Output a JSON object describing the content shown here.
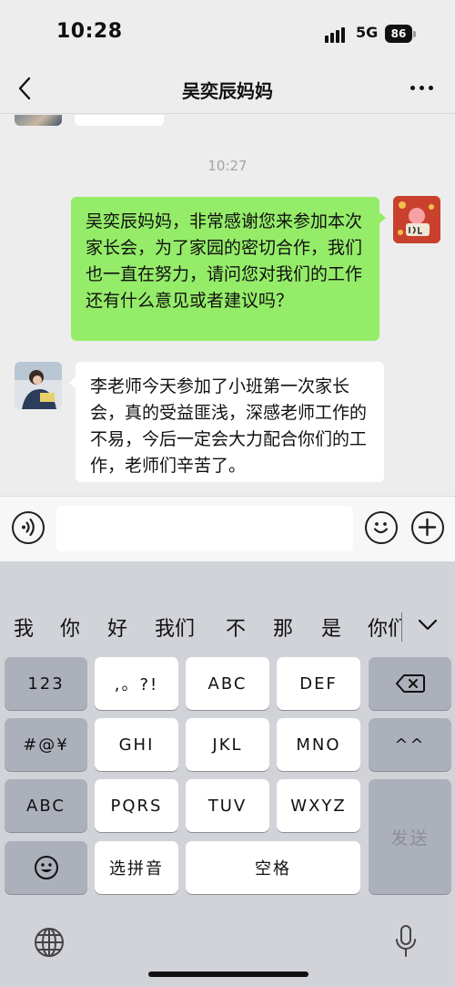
{
  "status_bar": {
    "time": "10:28",
    "network": "5G",
    "battery": "86"
  },
  "nav": {
    "title": "吴奕辰妈妈"
  },
  "chat": {
    "timestamp": "10:27",
    "messages": [
      {
        "sender": "me",
        "text": "吴奕辰妈妈，非常感谢您来参加本次家长会，为了家园的密切合作，我们也一直在努力，请问您对我们的工作还有什么意见或者建议吗？"
      },
      {
        "sender": "other",
        "text": "李老师今天参加了小班第一次家长会，真的受益匪浅，深感老师工作的不易，今后一定会大力配合你们的工作，老师们辛苦了。"
      }
    ]
  },
  "input": {
    "value": "",
    "placeholder": ""
  },
  "keyboard": {
    "candidates": [
      "我",
      "你",
      "好",
      "我们",
      "不",
      "那",
      "是",
      "你们"
    ],
    "keys": {
      "k123": "123",
      "punct": ",。?!",
      "abc": "ABC",
      "def": "DEF",
      "symbols": "#@¥",
      "ghi": "GHI",
      "jkl": "JKL",
      "mno": "MNO",
      "face": "^^",
      "abc_mode": "ABC",
      "pqrs": "PQRS",
      "tuv": "TUV",
      "wxyz": "WXYZ",
      "send": "发送",
      "pinyin": "选拼音",
      "space": "空格"
    }
  },
  "colors": {
    "my_bubble": "#95ec69",
    "their_bubble": "#ffffff",
    "background": "#ededed"
  },
  "icons": [
    "back-icon",
    "more-icon",
    "voice-icon",
    "emoji-icon",
    "plus-icon",
    "delete-icon",
    "emoji-key-icon",
    "globe-icon",
    "microphone-icon",
    "chevron-down-icon"
  ]
}
